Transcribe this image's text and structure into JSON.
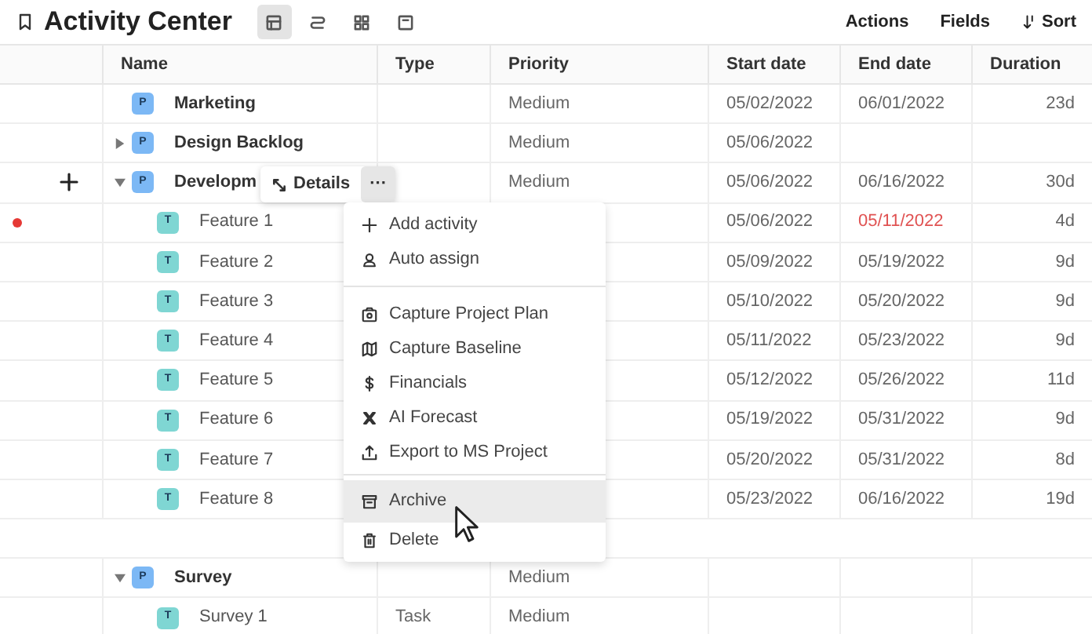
{
  "header": {
    "title": "Activity Center",
    "views": [
      {
        "selected": true
      },
      {
        "selected": false
      },
      {
        "selected": false
      },
      {
        "selected": false
      }
    ],
    "actions": [
      {
        "label": "Actions",
        "kind": "text"
      },
      {
        "label": "Fields",
        "kind": "text"
      },
      {
        "label": "Sort",
        "kind": "sort"
      }
    ]
  },
  "table": {
    "columns": [
      "Name",
      "Type",
      "Priority",
      "Start date",
      "End date",
      "Duration"
    ],
    "rows": [
      {
        "kind": "project",
        "badge": "P",
        "name": "Marketing",
        "priority": "Medium",
        "start": "05/02/2022",
        "end": "06/01/2022",
        "duration": "23d"
      },
      {
        "kind": "project",
        "badge": "P",
        "name": "Design Backlog",
        "expanded": false,
        "priority": "Medium",
        "start": "05/06/2022"
      },
      {
        "kind": "project",
        "badge": "P",
        "name": "Developm",
        "expanded": true,
        "hovered": true,
        "priority": "Medium",
        "start": "05/06/2022",
        "end": "06/16/2022",
        "duration": "30d"
      },
      {
        "kind": "task",
        "badge": "T",
        "name": "Feature 1",
        "flagged": true,
        "start": "05/06/2022",
        "end": "05/11/2022",
        "overdue": true,
        "duration": "4d"
      },
      {
        "kind": "task",
        "badge": "T",
        "name": "Feature 2",
        "start": "05/09/2022",
        "end": "05/19/2022",
        "duration": "9d"
      },
      {
        "kind": "task",
        "badge": "T",
        "name": "Feature 3",
        "start": "05/10/2022",
        "end": "05/20/2022",
        "duration": "9d"
      },
      {
        "kind": "task",
        "badge": "T",
        "name": "Feature 4",
        "start": "05/11/2022",
        "end": "05/23/2022",
        "duration": "9d"
      },
      {
        "kind": "task",
        "badge": "T",
        "name": "Feature 5",
        "start": "05/12/2022",
        "end": "05/26/2022",
        "duration": "11d"
      },
      {
        "kind": "task",
        "badge": "T",
        "name": "Feature 6",
        "start": "05/19/2022",
        "end": "05/31/2022",
        "duration": "9d"
      },
      {
        "kind": "task",
        "badge": "T",
        "name": "Feature 7",
        "start": "05/20/2022",
        "end": "05/31/2022",
        "duration": "8d"
      },
      {
        "kind": "task",
        "badge": "T",
        "name": "Feature 8",
        "start": "05/23/2022",
        "end": "06/16/2022",
        "duration": "19d"
      },
      {
        "kind": "blank"
      },
      {
        "kind": "project",
        "badge": "P",
        "name": "Survey",
        "expanded": true,
        "priority": "Medium"
      },
      {
        "kind": "task",
        "badge": "T",
        "name": "Survey 1",
        "type": "Task",
        "priority": "Medium"
      }
    ]
  },
  "row_popup": {
    "details": "Details",
    "more": "···"
  },
  "context_menu": {
    "groups": [
      [
        {
          "label": "Add activity",
          "highlighted": false
        },
        {
          "label": "Auto assign",
          "highlighted": false
        }
      ],
      [
        {
          "label": "Capture Project Plan",
          "highlighted": false
        },
        {
          "label": "Capture Baseline",
          "highlighted": false
        },
        {
          "label": "Financials",
          "highlighted": false
        },
        {
          "label": "AI Forecast",
          "highlighted": false
        },
        {
          "label": "Export to MS Project",
          "highlighted": false
        }
      ],
      [
        {
          "label": "Archive",
          "highlighted": true
        },
        {
          "label": "Delete",
          "highlighted": false
        }
      ]
    ]
  }
}
